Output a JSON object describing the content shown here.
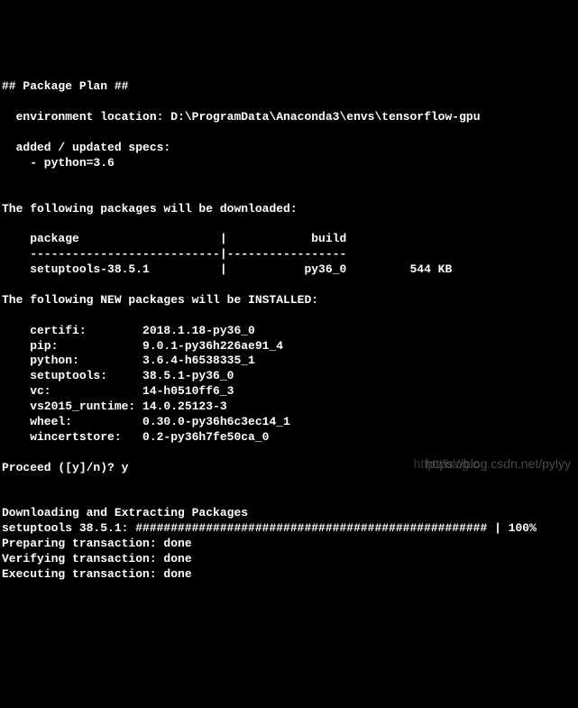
{
  "header": {
    "title": "## Package Plan ##",
    "env_label": "  environment location: ",
    "env_path": "D:\\ProgramData\\Anaconda3\\envs\\tensorflow-gpu",
    "specs_label": "  added / updated specs:",
    "spec_item": "    - python=3.6"
  },
  "download_section": {
    "heading": "The following packages will be downloaded:",
    "col_package": "    package                    |            build",
    "divider": "    ---------------------------|-----------------",
    "row1": "    setuptools-38.5.1          |           py36_0         544 KB"
  },
  "install_section": {
    "heading": "The following NEW packages will be INSTALLED:",
    "rows": [
      "    certifi:        2018.1.18-py36_0",
      "    pip:            9.0.1-py36h226ae91_4",
      "    python:         3.6.4-h6538335_1",
      "    setuptools:     38.5.1-py36_0",
      "    vc:             14-h0510ff6_3",
      "    vs2015_runtime: 14.0.25123-3",
      "    wheel:          0.30.0-py36h6c3ec14_1",
      "    wincertstore:   0.2-py36h7fe50ca_0"
    ]
  },
  "prompt": {
    "question": "Proceed ([y]/n)? ",
    "answer": "y"
  },
  "progress": {
    "heading": "Downloading and Extracting Packages",
    "bar": "setuptools 38.5.1: ################################################## | 100%",
    "prep": "Preparing transaction: done",
    "verify": "Verifying transaction: done",
    "exec": "Executing transaction: done"
  },
  "watermark": {
    "text1": "https://blog.csdn.net/pylyy",
    "text2": "http://blog.c"
  }
}
